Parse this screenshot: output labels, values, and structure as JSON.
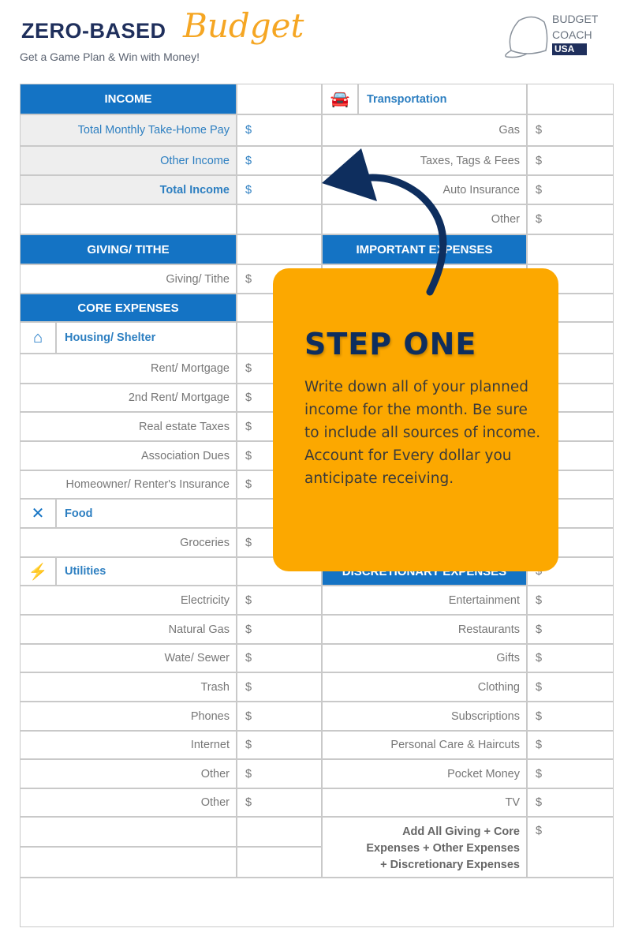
{
  "header": {
    "title": "ZERO-BASED",
    "title_script": "Budget",
    "tagline": "Get a Game Plan & Win with Money!",
    "logo": {
      "line1": "BUDGET",
      "line2": "COACH",
      "line3": "USA"
    }
  },
  "left": [
    {
      "type": "hdr",
      "label": "INCOME"
    },
    {
      "type": "gray",
      "label": "Total Monthly Take-Home Pay",
      "dollar": "$"
    },
    {
      "type": "gray",
      "label": "Other Income",
      "dollar": "$"
    },
    {
      "type": "gray",
      "label": "Total Income",
      "dollar": "$",
      "bold": true
    },
    {
      "type": "empty"
    },
    {
      "type": "hdr",
      "label": "GIVING/ TITHE"
    },
    {
      "type": "row",
      "label": "Giving/ Tithe",
      "dollar": "$"
    },
    {
      "type": "hdr",
      "label": "CORE EXPENSES"
    },
    {
      "type": "cat",
      "label": "Housing/ Shelter",
      "icon": "house-icon"
    },
    {
      "type": "row",
      "label": "Rent/ Mortgage",
      "dollar": "$"
    },
    {
      "type": "row",
      "label": "2nd Rent/ Mortgage",
      "dollar": "$"
    },
    {
      "type": "row",
      "label": "Real estate Taxes",
      "dollar": "$"
    },
    {
      "type": "row",
      "label": "Association Dues",
      "dollar": "$"
    },
    {
      "type": "row",
      "label": "Homeowner/ Renter's Insurance",
      "dollar": "$"
    },
    {
      "type": "cat",
      "label": "Food",
      "icon": "fork-knife-icon"
    },
    {
      "type": "row",
      "label": "Groceries",
      "dollar": "$"
    },
    {
      "type": "cat",
      "label": "Utilities",
      "icon": "plug-icon"
    },
    {
      "type": "row",
      "label": "Electricity",
      "dollar": "$"
    },
    {
      "type": "row",
      "label": "Natural Gas",
      "dollar": "$"
    },
    {
      "type": "row",
      "label": "Wate/ Sewer",
      "dollar": "$"
    },
    {
      "type": "row",
      "label": "Trash",
      "dollar": "$"
    },
    {
      "type": "row",
      "label": "Phones",
      "dollar": "$"
    },
    {
      "type": "row",
      "label": "Internet",
      "dollar": "$"
    },
    {
      "type": "row",
      "label": "Other",
      "dollar": "$"
    },
    {
      "type": "row",
      "label": "Other",
      "dollar": "$"
    },
    {
      "type": "empty"
    },
    {
      "type": "empty"
    }
  ],
  "right": [
    {
      "type": "cat",
      "label": "Transportation",
      "icon": "car-icon"
    },
    {
      "type": "row",
      "label": "Gas",
      "dollar": "$"
    },
    {
      "type": "row",
      "label": "Taxes, Tags & Fees",
      "dollar": "$"
    },
    {
      "type": "row",
      "label": "Auto Insurance",
      "dollar": "$"
    },
    {
      "type": "row",
      "label": "Other",
      "dollar": "$"
    },
    {
      "type": "hdr",
      "label": "IMPORTANT EXPENSES"
    },
    {
      "type": "empty"
    },
    {
      "type": "empty"
    },
    {
      "type": "empty"
    },
    {
      "type": "empty"
    },
    {
      "type": "empty"
    },
    {
      "type": "empty"
    },
    {
      "type": "empty"
    },
    {
      "type": "empty"
    },
    {
      "type": "empty"
    },
    {
      "type": "empty"
    },
    {
      "type": "hdr",
      "label": "DISCRETIONARY EXPENSES",
      "dollar": "$"
    },
    {
      "type": "row",
      "label": "Entertainment",
      "dollar": "$"
    },
    {
      "type": "row",
      "label": "Restaurants",
      "dollar": "$"
    },
    {
      "type": "row",
      "label": "Gifts",
      "dollar": "$"
    },
    {
      "type": "row",
      "label": "Clothing",
      "dollar": "$"
    },
    {
      "type": "row",
      "label": "Subscriptions",
      "dollar": "$"
    },
    {
      "type": "row",
      "label": "Personal Care & Haircuts",
      "dollar": "$"
    },
    {
      "type": "row",
      "label": "Pocket Money",
      "dollar": "$"
    },
    {
      "type": "row",
      "label": "TV",
      "dollar": "$"
    }
  ],
  "total": {
    "lines": [
      "Add All Giving + Core",
      "Expenses + Other Expenses",
      "+ Discretionary Expenses"
    ],
    "dollar": "$"
  },
  "callout": {
    "title": "STEP ONE",
    "body": "Write down all of your planned income for the month.  Be sure to include all sources of income. Account for Every dollar you anticipate receiving.",
    "color": "#fca800",
    "title_color": "#0e2e5e"
  },
  "colors": {
    "header_blue": "#1473c4",
    "label_blue": "#2d7fc1",
    "navy": "#1f2f5c",
    "orange": "#f5a623"
  }
}
